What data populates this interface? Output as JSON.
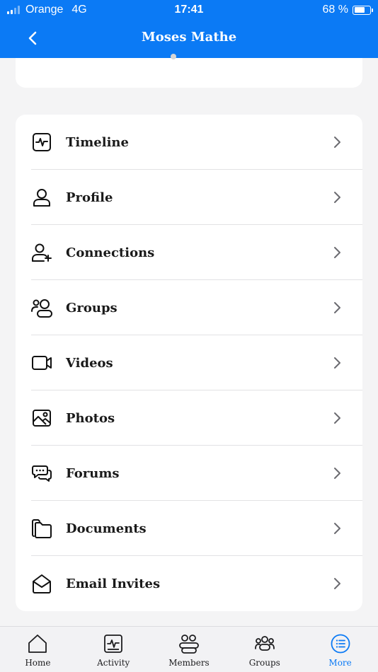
{
  "status_bar": {
    "carrier": "Orange",
    "network": "4G",
    "time": "17:41",
    "battery": "68 %",
    "battery_level": 0.68
  },
  "header": {
    "title": "Moses Mathe",
    "bg_color": "#0b7af5"
  },
  "menu": {
    "items": [
      {
        "label": "Timeline",
        "icon": "timeline-icon"
      },
      {
        "label": "Profile",
        "icon": "profile-icon"
      },
      {
        "label": "Connections",
        "icon": "connections-icon"
      },
      {
        "label": "Groups",
        "icon": "groups-icon"
      },
      {
        "label": "Videos",
        "icon": "videos-icon"
      },
      {
        "label": "Photos",
        "icon": "photos-icon"
      },
      {
        "label": "Forums",
        "icon": "forums-icon"
      },
      {
        "label": "Documents",
        "icon": "documents-icon"
      },
      {
        "label": "Email Invites",
        "icon": "email-invites-icon"
      }
    ]
  },
  "tabbar": {
    "tabs": [
      {
        "label": "Home",
        "icon": "home-icon"
      },
      {
        "label": "Activity",
        "icon": "activity-icon"
      },
      {
        "label": "Members",
        "icon": "members-icon"
      },
      {
        "label": "Groups",
        "icon": "groups-icon"
      },
      {
        "label": "More",
        "icon": "more-icon",
        "active": true
      }
    ],
    "active_color": "#0b7af5"
  }
}
